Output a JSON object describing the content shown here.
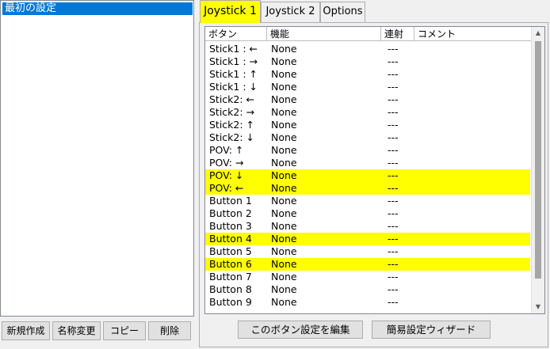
{
  "profiles": {
    "items": [
      "最初の設定"
    ],
    "buttons": {
      "new": "新規作成",
      "rename": "名称変更",
      "copy": "コピー",
      "delete": "削除"
    }
  },
  "tabs": [
    {
      "label": "Joystick 1",
      "active": true
    },
    {
      "label": "Joystick 2",
      "active": false
    },
    {
      "label": "Options",
      "active": false
    }
  ],
  "table": {
    "columns": [
      "ボタン",
      "機能",
      "連射",
      "コメント"
    ],
    "rows": [
      {
        "button": "Stick1 : ←",
        "function": "None",
        "rapid": "---",
        "highlight": false
      },
      {
        "button": "Stick1 : →",
        "function": "None",
        "rapid": "---",
        "highlight": false
      },
      {
        "button": "Stick1 : ↑",
        "function": "None",
        "rapid": "---",
        "highlight": false
      },
      {
        "button": "Stick1 : ↓",
        "function": "None",
        "rapid": "---",
        "highlight": false
      },
      {
        "button": "Stick2: ←",
        "function": "None",
        "rapid": "---",
        "highlight": false
      },
      {
        "button": "Stick2: →",
        "function": "None",
        "rapid": "---",
        "highlight": false
      },
      {
        "button": "Stick2: ↑",
        "function": "None",
        "rapid": "---",
        "highlight": false
      },
      {
        "button": "Stick2: ↓",
        "function": "None",
        "rapid": "---",
        "highlight": false
      },
      {
        "button": "POV: ↑",
        "function": "None",
        "rapid": "---",
        "highlight": false
      },
      {
        "button": "POV: →",
        "function": "None",
        "rapid": "---",
        "highlight": false
      },
      {
        "button": "POV: ↓",
        "function": "None",
        "rapid": "---",
        "highlight": true
      },
      {
        "button": "POV: ←",
        "function": "None",
        "rapid": "---",
        "highlight": true
      },
      {
        "button": "Button 1",
        "function": "None",
        "rapid": "---",
        "highlight": false
      },
      {
        "button": "Button 2",
        "function": "None",
        "rapid": "---",
        "highlight": false
      },
      {
        "button": "Button 3",
        "function": "None",
        "rapid": "---",
        "highlight": false
      },
      {
        "button": "Button 4",
        "function": "None",
        "rapid": "---",
        "highlight": true
      },
      {
        "button": "Button 5",
        "function": "None",
        "rapid": "---",
        "highlight": false
      },
      {
        "button": "Button 6",
        "function": "None",
        "rapid": "---",
        "highlight": true
      },
      {
        "button": "Button 7",
        "function": "None",
        "rapid": "---",
        "highlight": false
      },
      {
        "button": "Button 8",
        "function": "None",
        "rapid": "---",
        "highlight": false
      },
      {
        "button": "Button 9",
        "function": "None",
        "rapid": "---",
        "highlight": false
      }
    ]
  },
  "actions": {
    "edit": "このボタン設定を編集",
    "wizard": "簡易設定ウィザード"
  },
  "icons": {
    "scroll_up": "scroll-up-icon",
    "scroll_down": "scroll-down-icon"
  },
  "colors": {
    "selection": "#0078d7",
    "highlight": "#ffff00"
  }
}
